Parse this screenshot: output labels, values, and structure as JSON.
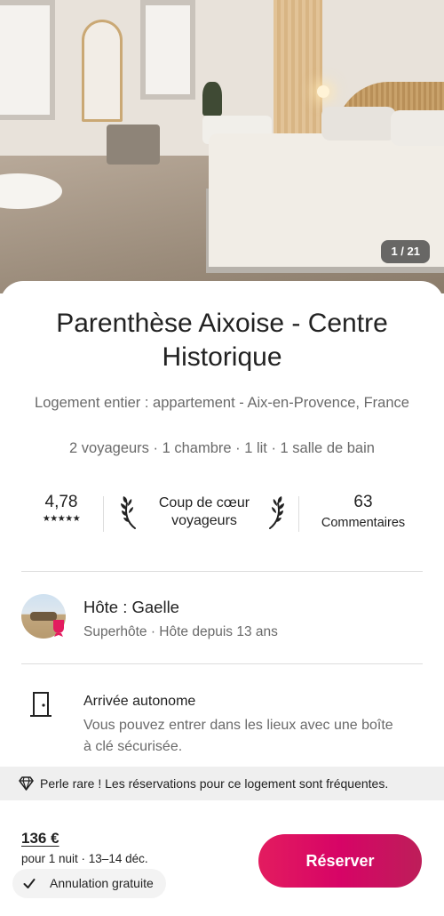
{
  "listing": {
    "photo_counter": "1 / 21",
    "title": "Parenthèse Aixoise - Centre Historique",
    "subtitle": "Logement entier : appartement - Aix-en-Provence, France",
    "specs": "2 voyageurs · 1 chambre · 1 lit · 1 salle de bain"
  },
  "stats": {
    "rating": "4,78",
    "stars": "★★★★★",
    "stars_value": 5,
    "favorite_label": "Coup de cœur voyageurs",
    "reviews_count": "63",
    "reviews_label": "Commentaires"
  },
  "host": {
    "name": "Hôte : Gaelle",
    "details": "Superhôte · Hôte depuis 13 ans"
  },
  "highlight": {
    "title": "Arrivée autonome",
    "description": "Vous pouvez entrer dans les lieux avec une boîte à clé sécurisée."
  },
  "banner": {
    "text": "Perle rare ! Les réservations pour ce logement sont fréquentes."
  },
  "footer": {
    "price": "136 €",
    "price_details": "pour 1 nuit · 13–14 déc.",
    "cancellation": "Annulation gratuite",
    "reserve_label": "Réserver"
  },
  "colors": {
    "brand": "#e31c5f",
    "text": "#222222",
    "secondary_text": "#6a6a6a",
    "divider": "#dddddd"
  },
  "icons": {
    "laurel": "laurel-icon",
    "door": "door-icon",
    "diamond": "diamond-icon",
    "check": "check-icon",
    "superhost": "superhost-badge-icon"
  }
}
